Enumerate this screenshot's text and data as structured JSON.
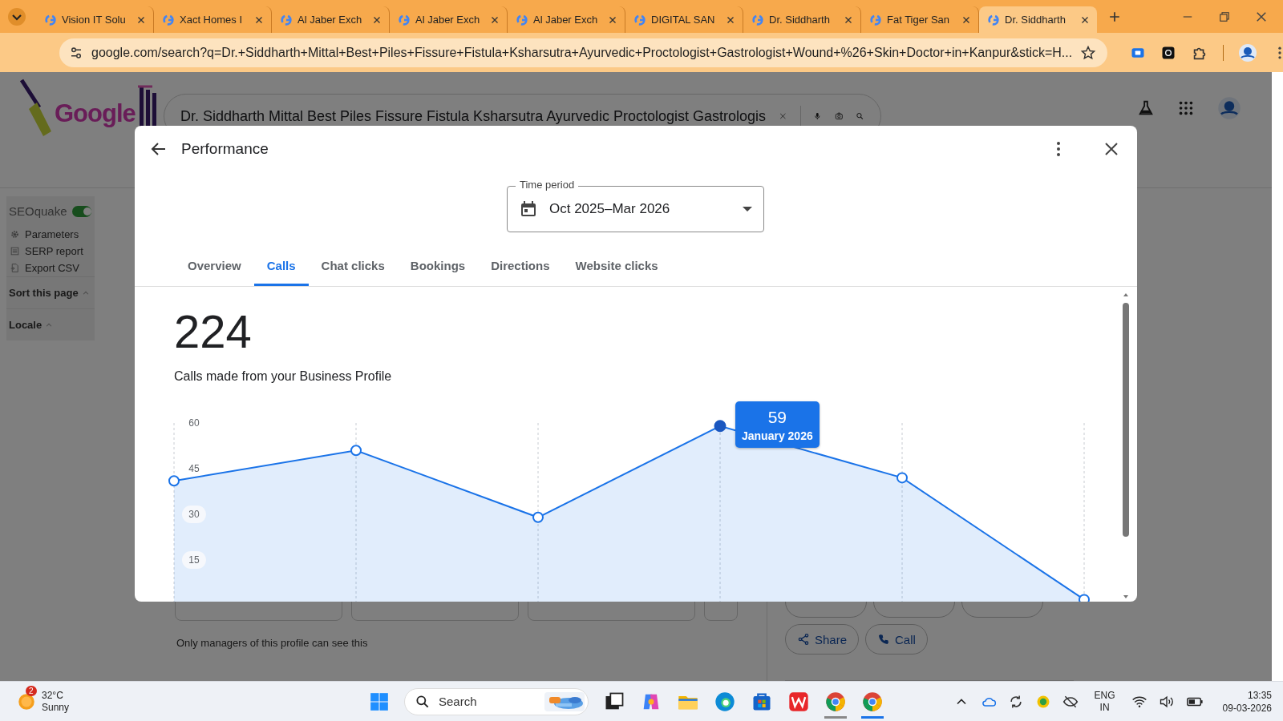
{
  "browser": {
    "tabs": [
      {
        "title": "Vision IT Solu",
        "selected": false
      },
      {
        "title": "Xact Homes I",
        "selected": false
      },
      {
        "title": "Al Jaber Exch",
        "selected": false
      },
      {
        "title": "Al Jaber Exch",
        "selected": false
      },
      {
        "title": "Al Jaber Exch",
        "selected": false
      },
      {
        "title": "DIGITAL SAN",
        "selected": false
      },
      {
        "title": "Dr. Siddharth",
        "selected": false
      },
      {
        "title": "Fat Tiger San",
        "selected": false
      },
      {
        "title": "Dr. Siddharth",
        "selected": true
      }
    ],
    "address": "google.com/search?q=Dr.+Siddharth+Mittal+Best+Piles+Fissure+Fistula+Ksharsutra+Ayurvedic+Proctologist+Gastrologist+Wound+%26+Skin+Doctor+in+Kanpur&stick=H..."
  },
  "background_page": {
    "logo_text": "Google",
    "search_query": "Dr. Siddharth Mittal Best Piles Fissure Fistula Ksharsutra Ayurvedic Proctologist Gastrologis",
    "seoquake": {
      "title": "SEOquake",
      "enabled": true,
      "items": [
        "Parameters",
        "SERP report",
        "Export CSV"
      ],
      "sections": [
        "Sort this page",
        "Locale"
      ]
    },
    "footnote": "Only managers of this profile can see this",
    "actions": [
      "Share",
      "Call"
    ]
  },
  "dialog": {
    "title": "Performance",
    "time_period": {
      "label": "Time period",
      "value": "Oct 2025–Mar 2026"
    },
    "tabs": [
      {
        "label": "Overview",
        "selected": false
      },
      {
        "label": "Calls",
        "selected": true
      },
      {
        "label": "Chat clicks",
        "selected": false
      },
      {
        "label": "Bookings",
        "selected": false
      },
      {
        "label": "Directions",
        "selected": false
      },
      {
        "label": "Website clicks",
        "selected": false
      }
    ],
    "metric": {
      "value": "224",
      "caption": "Calls made from your Business Profile"
    },
    "chart_data": {
      "type": "area",
      "categories": [
        null,
        null,
        null,
        null,
        null,
        null
      ],
      "ylim": [
        0,
        60
      ],
      "yticks": [
        15,
        30,
        45,
        60
      ],
      "grid": true,
      "series": [
        {
          "color": "#1a73e8",
          "values": [
            41,
            51,
            29,
            59,
            42,
            2
          ]
        }
      ]
    },
    "tooltip": {
      "value": "59",
      "label": "January 2026"
    }
  },
  "taskbar": {
    "weather": {
      "badge": "2",
      "temperature": "32°C",
      "condition": "Sunny"
    },
    "search_placeholder": "Search",
    "language": "ENG",
    "region": "IN",
    "time": "13:35",
    "date": "09-03-2026"
  }
}
